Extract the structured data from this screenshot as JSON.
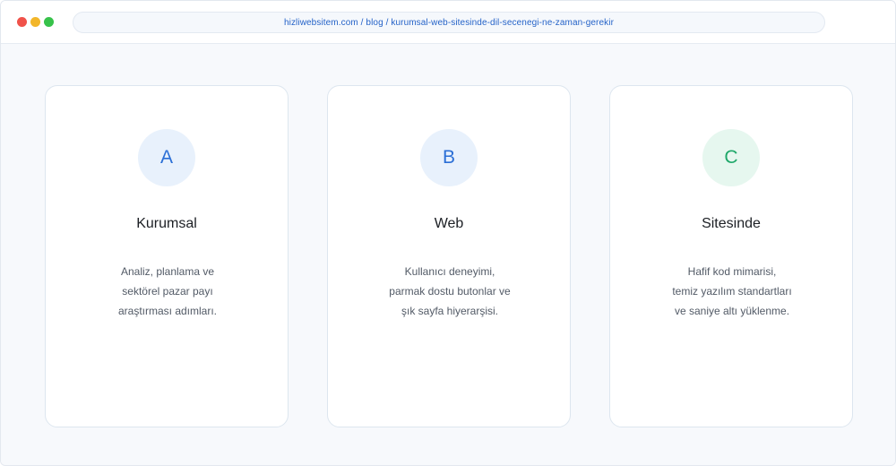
{
  "window": {
    "url": "hizliwebsitem.com / blog / kurumsal-web-sitesinde-dil-secenegi-ne-zaman-gerekir",
    "controls": {
      "close_color": "#f0524a",
      "minimize_color": "#f2b62a",
      "maximize_color": "#37c24a"
    }
  },
  "cards": [
    {
      "letter": "A",
      "letter_color": "#2b6fd6",
      "badge_bg": "#e8f1fc",
      "title": "Kurumsal",
      "lines": [
        "Analiz, planlama ve",
        "sektörel pazar payı",
        "araştırması adımları."
      ]
    },
    {
      "letter": "B",
      "letter_color": "#2b6fd6",
      "badge_bg": "#e8f1fc",
      "title": "Web",
      "lines": [
        "Kullanıcı deneyimi,",
        "parmak dostu butonlar ve",
        "şık sayfa hiyerarşisi."
      ]
    },
    {
      "letter": "C",
      "letter_color": "#1fa86a",
      "badge_bg": "#e6f7ef",
      "title": "Sitesinde",
      "lines": [
        "Hafif kod mimarisi,",
        "temiz yazılım standartları",
        "ve saniye altı yüklenme."
      ]
    }
  ]
}
